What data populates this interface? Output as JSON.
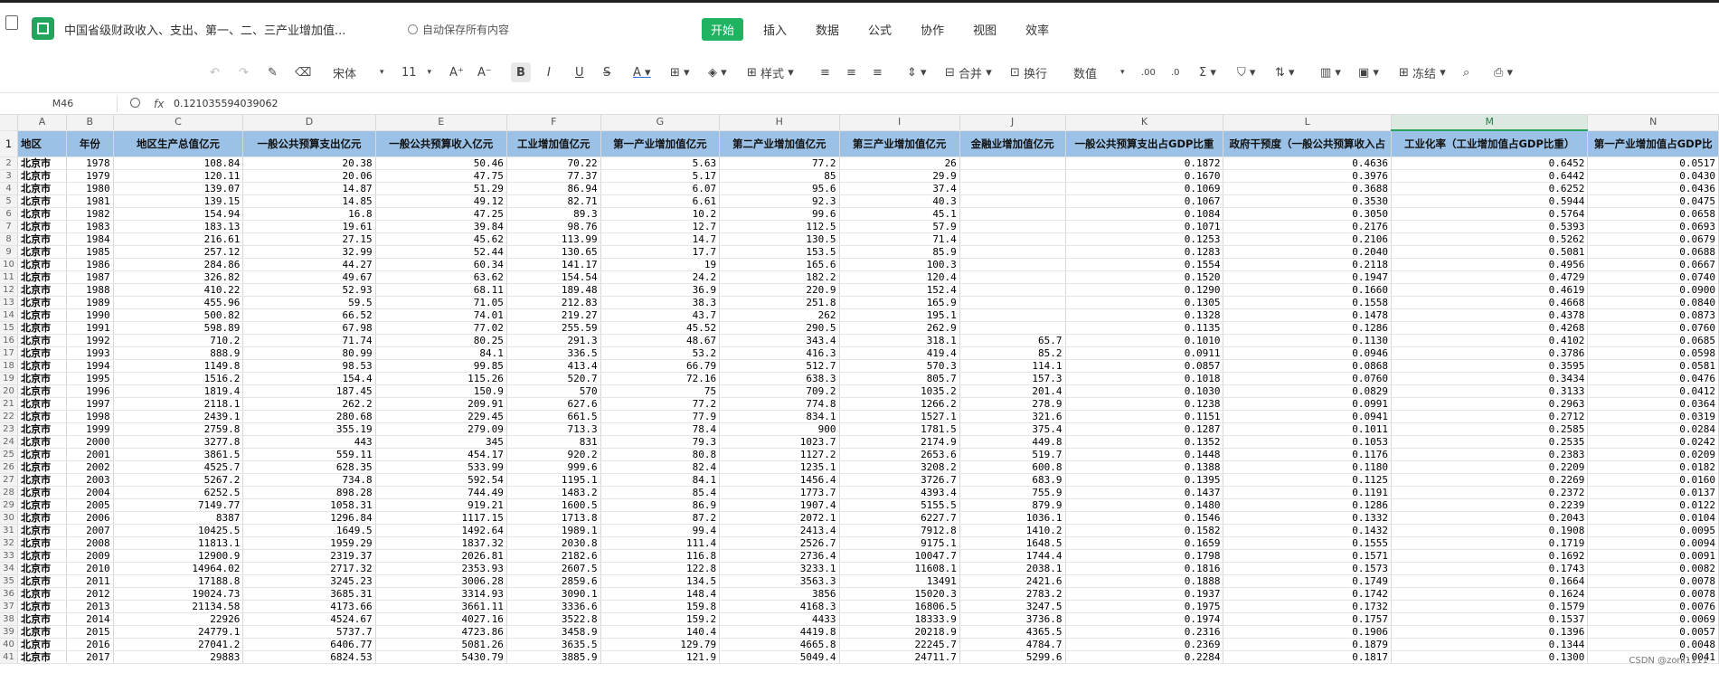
{
  "app": {
    "doc_title": "中国省级财政收入、支出、第一、二、三产业增加值...",
    "autosave": "自动保存所有内容"
  },
  "menu": [
    "开始",
    "插入",
    "数据",
    "公式",
    "协作",
    "视图",
    "效率"
  ],
  "toolbar": {
    "font_name": "宋体",
    "font_size": "11",
    "style_label": "样式",
    "merge_label": "合并",
    "wrap_label": "换行",
    "number_format": "数值",
    "freeze_label": "冻结"
  },
  "formula_bar": {
    "cell_ref": "M46",
    "fx": "fx",
    "value": "0.121035594039062"
  },
  "columns": [
    "A",
    "B",
    "C",
    "D",
    "E",
    "F",
    "G",
    "H",
    "I",
    "J",
    "K",
    "L",
    "M",
    "N"
  ],
  "headers": [
    "地区",
    "年份",
    "地区生产总值亿元",
    "一般公共预算支出亿元",
    "一般公共预算收入亿元",
    "工业增加值亿元",
    "第一产业增加值亿元",
    "第二产业增加值亿元",
    "第三产业增加值亿元",
    "金融业增加值亿元",
    "一般公共预算支出占GDP比重",
    "政府干预度（一般公共预算收入占",
    "工业化率（工业增加值占GDP比重）",
    "第一产业增加值占GDP比"
  ],
  "rows": [
    [
      "北京市",
      "1978",
      "108.84",
      "20.38",
      "50.46",
      "70.22",
      "5.63",
      "77.2",
      "26",
      "",
      "0.1872",
      "0.4636",
      "0.6452",
      "0.0517"
    ],
    [
      "北京市",
      "1979",
      "120.11",
      "20.06",
      "47.75",
      "77.37",
      "5.17",
      "85",
      "29.9",
      "",
      "0.1670",
      "0.3976",
      "0.6442",
      "0.0430"
    ],
    [
      "北京市",
      "1980",
      "139.07",
      "14.87",
      "51.29",
      "86.94",
      "6.07",
      "95.6",
      "37.4",
      "",
      "0.1069",
      "0.3688",
      "0.6252",
      "0.0436"
    ],
    [
      "北京市",
      "1981",
      "139.15",
      "14.85",
      "49.12",
      "82.71",
      "6.61",
      "92.3",
      "40.3",
      "",
      "0.1067",
      "0.3530",
      "0.5944",
      "0.0475"
    ],
    [
      "北京市",
      "1982",
      "154.94",
      "16.8",
      "47.25",
      "89.3",
      "10.2",
      "99.6",
      "45.1",
      "",
      "0.1084",
      "0.3050",
      "0.5764",
      "0.0658"
    ],
    [
      "北京市",
      "1983",
      "183.13",
      "19.61",
      "39.84",
      "98.76",
      "12.7",
      "112.5",
      "57.9",
      "",
      "0.1071",
      "0.2176",
      "0.5393",
      "0.0693"
    ],
    [
      "北京市",
      "1984",
      "216.61",
      "27.15",
      "45.62",
      "113.99",
      "14.7",
      "130.5",
      "71.4",
      "",
      "0.1253",
      "0.2106",
      "0.5262",
      "0.0679"
    ],
    [
      "北京市",
      "1985",
      "257.12",
      "32.99",
      "52.44",
      "130.65",
      "17.7",
      "153.5",
      "85.9",
      "",
      "0.1283",
      "0.2040",
      "0.5081",
      "0.0688"
    ],
    [
      "北京市",
      "1986",
      "284.86",
      "44.27",
      "60.34",
      "141.17",
      "19",
      "165.6",
      "100.3",
      "",
      "0.1554",
      "0.2118",
      "0.4956",
      "0.0667"
    ],
    [
      "北京市",
      "1987",
      "326.82",
      "49.67",
      "63.62",
      "154.54",
      "24.2",
      "182.2",
      "120.4",
      "",
      "0.1520",
      "0.1947",
      "0.4729",
      "0.0740"
    ],
    [
      "北京市",
      "1988",
      "410.22",
      "52.93",
      "68.11",
      "189.48",
      "36.9",
      "220.9",
      "152.4",
      "",
      "0.1290",
      "0.1660",
      "0.4619",
      "0.0900"
    ],
    [
      "北京市",
      "1989",
      "455.96",
      "59.5",
      "71.05",
      "212.83",
      "38.3",
      "251.8",
      "165.9",
      "",
      "0.1305",
      "0.1558",
      "0.4668",
      "0.0840"
    ],
    [
      "北京市",
      "1990",
      "500.82",
      "66.52",
      "74.01",
      "219.27",
      "43.7",
      "262",
      "195.1",
      "",
      "0.1328",
      "0.1478",
      "0.4378",
      "0.0873"
    ],
    [
      "北京市",
      "1991",
      "598.89",
      "67.98",
      "77.02",
      "255.59",
      "45.52",
      "290.5",
      "262.9",
      "",
      "0.1135",
      "0.1286",
      "0.4268",
      "0.0760"
    ],
    [
      "北京市",
      "1992",
      "710.2",
      "71.74",
      "80.25",
      "291.3",
      "48.67",
      "343.4",
      "318.1",
      "65.7",
      "0.1010",
      "0.1130",
      "0.4102",
      "0.0685"
    ],
    [
      "北京市",
      "1993",
      "888.9",
      "80.99",
      "84.1",
      "336.5",
      "53.2",
      "416.3",
      "419.4",
      "85.2",
      "0.0911",
      "0.0946",
      "0.3786",
      "0.0598"
    ],
    [
      "北京市",
      "1994",
      "1149.8",
      "98.53",
      "99.85",
      "413.4",
      "66.79",
      "512.7",
      "570.3",
      "114.1",
      "0.0857",
      "0.0868",
      "0.3595",
      "0.0581"
    ],
    [
      "北京市",
      "1995",
      "1516.2",
      "154.4",
      "115.26",
      "520.7",
      "72.16",
      "638.3",
      "805.7",
      "157.3",
      "0.1018",
      "0.0760",
      "0.3434",
      "0.0476"
    ],
    [
      "北京市",
      "1996",
      "1819.4",
      "187.45",
      "150.9",
      "570",
      "75",
      "709.2",
      "1035.2",
      "201.4",
      "0.1030",
      "0.0829",
      "0.3133",
      "0.0412"
    ],
    [
      "北京市",
      "1997",
      "2118.1",
      "262.2",
      "209.91",
      "627.6",
      "77.2",
      "774.8",
      "1266.2",
      "278.9",
      "0.1238",
      "0.0991",
      "0.2963",
      "0.0364"
    ],
    [
      "北京市",
      "1998",
      "2439.1",
      "280.68",
      "229.45",
      "661.5",
      "77.9",
      "834.1",
      "1527.1",
      "321.6",
      "0.1151",
      "0.0941",
      "0.2712",
      "0.0319"
    ],
    [
      "北京市",
      "1999",
      "2759.8",
      "355.19",
      "279.09",
      "713.3",
      "78.4",
      "900",
      "1781.5",
      "375.4",
      "0.1287",
      "0.1011",
      "0.2585",
      "0.0284"
    ],
    [
      "北京市",
      "2000",
      "3277.8",
      "443",
      "345",
      "831",
      "79.3",
      "1023.7",
      "2174.9",
      "449.8",
      "0.1352",
      "0.1053",
      "0.2535",
      "0.0242"
    ],
    [
      "北京市",
      "2001",
      "3861.5",
      "559.11",
      "454.17",
      "920.2",
      "80.8",
      "1127.2",
      "2653.6",
      "519.7",
      "0.1448",
      "0.1176",
      "0.2383",
      "0.0209"
    ],
    [
      "北京市",
      "2002",
      "4525.7",
      "628.35",
      "533.99",
      "999.6",
      "82.4",
      "1235.1",
      "3208.2",
      "600.8",
      "0.1388",
      "0.1180",
      "0.2209",
      "0.0182"
    ],
    [
      "北京市",
      "2003",
      "5267.2",
      "734.8",
      "592.54",
      "1195.1",
      "84.1",
      "1456.4",
      "3726.7",
      "683.9",
      "0.1395",
      "0.1125",
      "0.2269",
      "0.0160"
    ],
    [
      "北京市",
      "2004",
      "6252.5",
      "898.28",
      "744.49",
      "1483.2",
      "85.4",
      "1773.7",
      "4393.4",
      "755.9",
      "0.1437",
      "0.1191",
      "0.2372",
      "0.0137"
    ],
    [
      "北京市",
      "2005",
      "7149.77",
      "1058.31",
      "919.21",
      "1600.5",
      "86.9",
      "1907.4",
      "5155.5",
      "879.9",
      "0.1480",
      "0.1286",
      "0.2239",
      "0.0122"
    ],
    [
      "北京市",
      "2006",
      "8387",
      "1296.84",
      "1117.15",
      "1713.8",
      "87.2",
      "2072.1",
      "6227.7",
      "1036.1",
      "0.1546",
      "0.1332",
      "0.2043",
      "0.0104"
    ],
    [
      "北京市",
      "2007",
      "10425.5",
      "1649.5",
      "1492.64",
      "1989.1",
      "99.4",
      "2413.4",
      "7912.8",
      "1410.2",
      "0.1582",
      "0.1432",
      "0.1908",
      "0.0095"
    ],
    [
      "北京市",
      "2008",
      "11813.1",
      "1959.29",
      "1837.32",
      "2030.8",
      "111.4",
      "2526.7",
      "9175.1",
      "1648.5",
      "0.1659",
      "0.1555",
      "0.1719",
      "0.0094"
    ],
    [
      "北京市",
      "2009",
      "12900.9",
      "2319.37",
      "2026.81",
      "2182.6",
      "116.8",
      "2736.4",
      "10047.7",
      "1744.4",
      "0.1798",
      "0.1571",
      "0.1692",
      "0.0091"
    ],
    [
      "北京市",
      "2010",
      "14964.02",
      "2717.32",
      "2353.93",
      "2607.5",
      "122.8",
      "3233.1",
      "11608.1",
      "2038.1",
      "0.1816",
      "0.1573",
      "0.1743",
      "0.0082"
    ],
    [
      "北京市",
      "2011",
      "17188.8",
      "3245.23",
      "3006.28",
      "2859.6",
      "134.5",
      "3563.3",
      "13491",
      "2421.6",
      "0.1888",
      "0.1749",
      "0.1664",
      "0.0078"
    ],
    [
      "北京市",
      "2012",
      "19024.73",
      "3685.31",
      "3314.93",
      "3090.1",
      "148.4",
      "3856",
      "15020.3",
      "2783.2",
      "0.1937",
      "0.1742",
      "0.1624",
      "0.0078"
    ],
    [
      "北京市",
      "2013",
      "21134.58",
      "4173.66",
      "3661.11",
      "3336.6",
      "159.8",
      "4168.3",
      "16806.5",
      "3247.5",
      "0.1975",
      "0.1732",
      "0.1579",
      "0.0076"
    ],
    [
      "北京市",
      "2014",
      "22926",
      "4524.67",
      "4027.16",
      "3522.8",
      "159.2",
      "4433",
      "18333.9",
      "3736.8",
      "0.1974",
      "0.1757",
      "0.1537",
      "0.0069"
    ],
    [
      "北京市",
      "2015",
      "24779.1",
      "5737.7",
      "4723.86",
      "3458.9",
      "140.4",
      "4419.8",
      "20218.9",
      "4365.5",
      "0.2316",
      "0.1906",
      "0.1396",
      "0.0057"
    ],
    [
      "北京市",
      "2016",
      "27041.2",
      "6406.77",
      "5081.26",
      "3635.5",
      "129.79",
      "4665.8",
      "22245.7",
      "4784.7",
      "0.2369",
      "0.1879",
      "0.1344",
      "0.0048"
    ],
    [
      "北京市",
      "2017",
      "29883",
      "6824.53",
      "5430.79",
      "3885.9",
      "121.9",
      "5049.4",
      "24711.7",
      "5299.6",
      "0.2284",
      "0.1817",
      "0.1300",
      "0.0041"
    ]
  ],
  "watermark": "CSDN @zoni1111"
}
